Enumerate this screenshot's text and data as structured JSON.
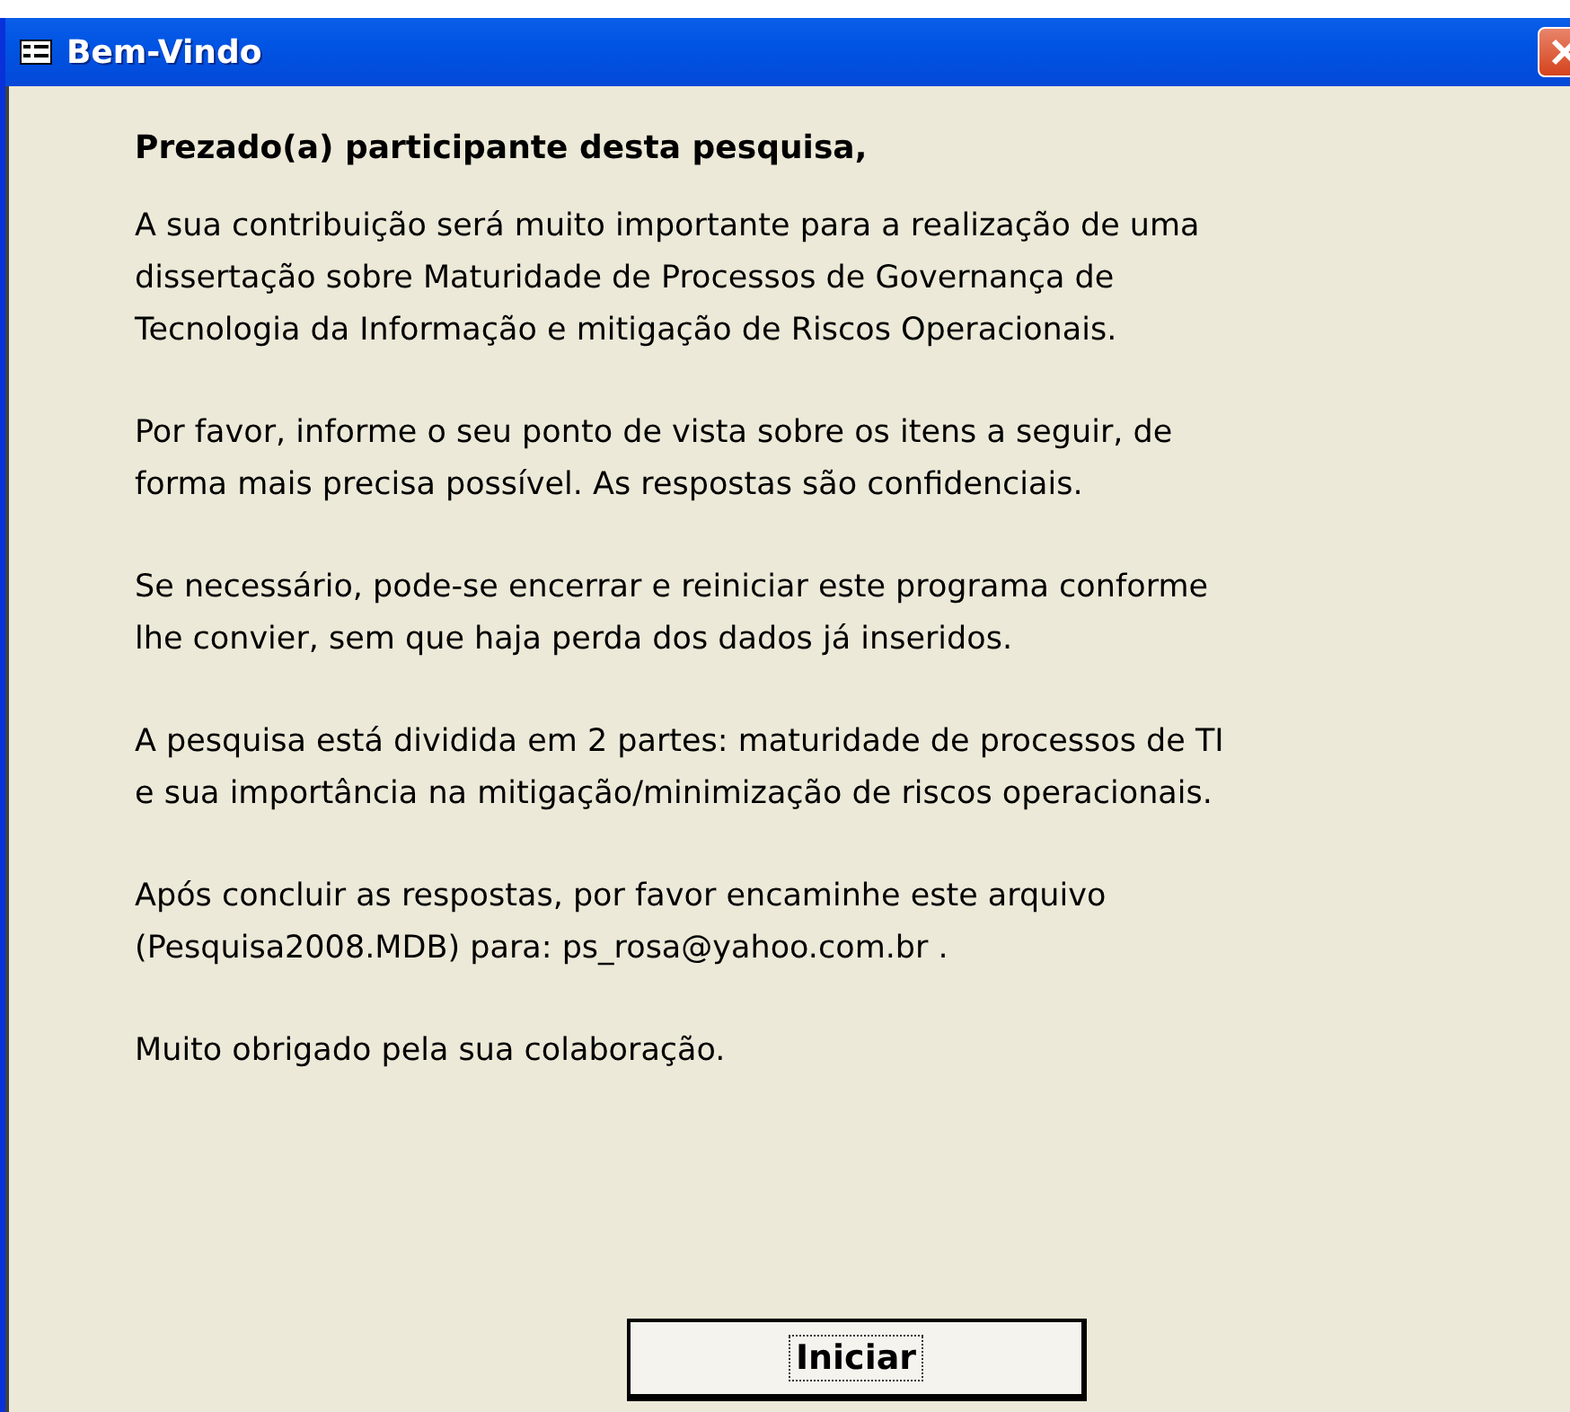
{
  "window": {
    "title": "Bem-Vindo"
  },
  "heading": "Prezado(a) participante desta pesquisa,",
  "paragraphs": [
    "A sua contribuição será muito importante para a realização de uma\ndissertação sobre Maturidade de Processos de Governança de\nTecnologia da Informação e mitigação de Riscos Operacionais.",
    "Por favor, informe o seu ponto de vista sobre os itens a seguir, de\nforma mais precisa possível. As respostas são confidenciais.",
    "Se necessário, pode-se encerrar e reiniciar este programa conforme\nlhe convier, sem que haja perda dos dados já inseridos.",
    "A pesquisa está dividida em 2 partes: maturidade de processos de TI\ne sua importância na mitigação/minimização de riscos operacionais.",
    "Após concluir as respostas, por favor encaminhe este arquivo\n(Pesquisa2008.MDB) para: ps_rosa@yahoo.com.br .",
    "Muito obrigado pela sua colaboração."
  ],
  "button": {
    "label": "Iniciar",
    "focused": true
  }
}
